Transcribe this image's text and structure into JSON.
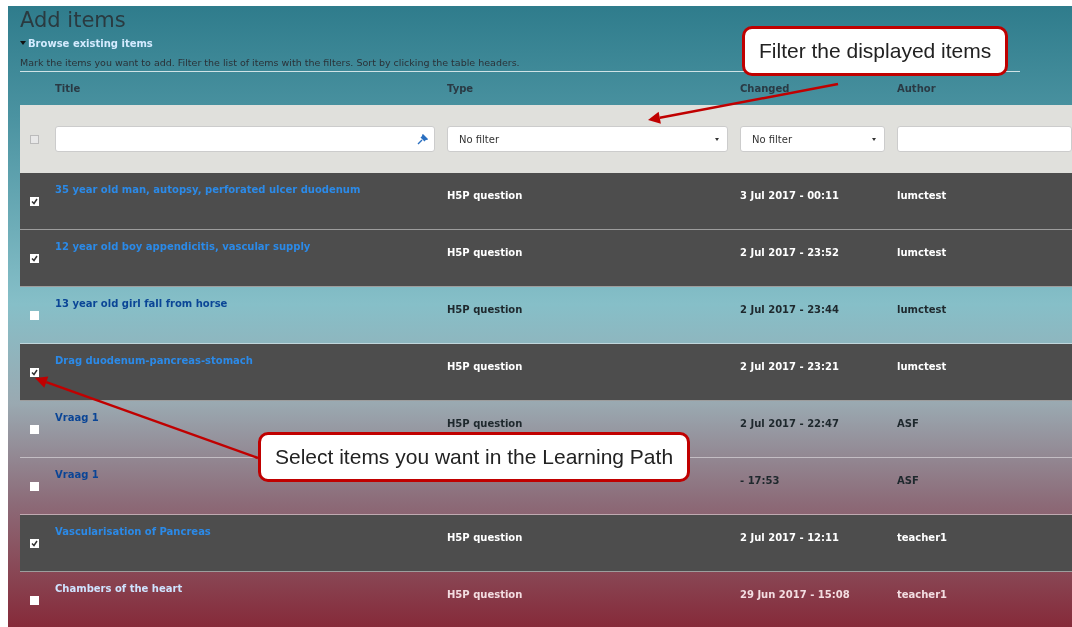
{
  "page": {
    "title": "Add items",
    "browse_link": "Browse existing items",
    "instructions": "Mark the items you want to add. Filter the list of items with the filters. Sort by clicking the table headers."
  },
  "columns": [
    "Title",
    "Type",
    "Changed",
    "Author"
  ],
  "filters": {
    "select_all_checked": false,
    "type": "No filter",
    "changed": "No filter"
  },
  "rows": [
    {
      "title": "35 year old man, autopsy, perforated ulcer duodenum",
      "type": "H5P question",
      "changed": "3 Jul 2017 - 00:11",
      "author": "lumctest",
      "selected": true
    },
    {
      "title": "12 year old boy appendicitis, vascular supply",
      "type": "H5P question",
      "changed": "2 Jul 2017 - 23:52",
      "author": "lumctest",
      "selected": true
    },
    {
      "title": "13 year old girl fall from horse",
      "type": "H5P question",
      "changed": "2 Jul 2017 - 23:44",
      "author": "lumctest",
      "selected": false
    },
    {
      "title": "Drag duodenum-pancreas-stomach",
      "type": "H5P question",
      "changed": "2 Jul 2017 - 23:21",
      "author": "lumctest",
      "selected": true
    },
    {
      "title": "Vraag 1",
      "type": "H5P question",
      "changed": "2 Jul 2017 - 22:47",
      "author": "ASF",
      "selected": false
    },
    {
      "title": "Vraag 1",
      "changed": "- 17:53",
      "author": "ASF",
      "selected": false
    },
    {
      "title": "Vascularisation of Pancreas",
      "type": "H5P question",
      "changed": "2 Jul 2017 - 12:11",
      "author": "teacher1",
      "selected": true
    },
    {
      "title": "Chambers of the heart",
      "type": "H5P question",
      "changed": "29 Jun 2017 - 15:08",
      "author": "teacher1",
      "selected": false
    }
  ],
  "callouts": [
    {
      "text": "Filter the displayed items"
    },
    {
      "text": "Select items you want in the Learning Path"
    }
  ]
}
